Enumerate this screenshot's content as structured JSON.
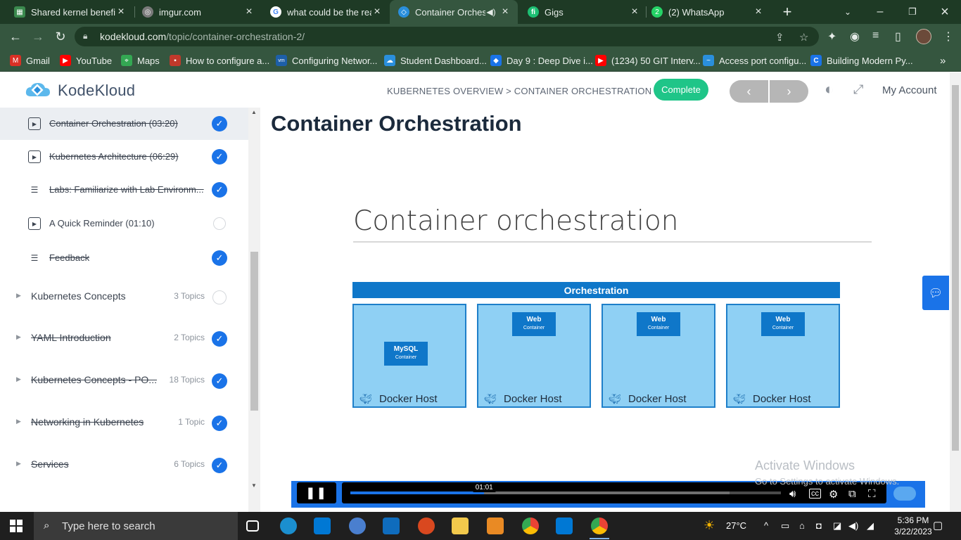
{
  "browser": {
    "tabs": [
      {
        "title": "Shared kernel benefits",
        "icon": "page-icon",
        "color": "#3b8a4e"
      },
      {
        "title": "imgur.com",
        "icon": "globe-icon",
        "color": "#7a7a7a"
      },
      {
        "title": "what could be the rea",
        "icon": "google-icon",
        "color": "#ffffff"
      },
      {
        "title": "Container Orchest",
        "icon": "kodekloud-icon",
        "color": "#2a8fdc",
        "active": true
      },
      {
        "title": "Gigs",
        "icon": "fiverr-icon",
        "color": "#1dbf73"
      },
      {
        "title": "(2) WhatsApp",
        "icon": "whatsapp-icon",
        "color": "#25d366"
      }
    ],
    "url_host": "kodekloud.com",
    "url_path": "/topic/container-orchestration-2/",
    "bookmarks": [
      {
        "label": "Gmail",
        "icon": "gmail-icon",
        "color": "#d93025"
      },
      {
        "label": "YouTube",
        "icon": "youtube-icon",
        "color": "#ff0000"
      },
      {
        "label": "Maps",
        "icon": "maps-icon",
        "color": "#34a853"
      },
      {
        "label": "How to configure a...",
        "icon": "bookmark-icon",
        "color": "#c0392b"
      },
      {
        "label": "Configuring Networ...",
        "icon": "vmware-icon",
        "color": "#1d5fa8"
      },
      {
        "label": "Student Dashboard...",
        "icon": "cloud-icon",
        "color": "#2a8fdc"
      },
      {
        "label": "Day 9 : Deep Dive i...",
        "icon": "diamond-icon",
        "color": "#1a73e8"
      },
      {
        "label": "(1234) 50 GIT Interv...",
        "icon": "youtube-icon",
        "color": "#ff0000"
      },
      {
        "label": "Access port configu...",
        "icon": "wave-icon",
        "color": "#2a8fdc"
      },
      {
        "label": "Building Modern Py...",
        "icon": "c-icon",
        "color": "#1a73e8"
      }
    ]
  },
  "header": {
    "logo_text": "KodeKloud",
    "breadcrumb": "KUBERNETES OVERVIEW > CONTAINER ORCHESTRATION",
    "complete_label": "Complete",
    "prev_label": "‹",
    "next_label": "›",
    "account_label": "My Account"
  },
  "sidebar": {
    "lessons": [
      {
        "label": "Container Orchestration (03:20)",
        "type": "video",
        "done": true,
        "current": true
      },
      {
        "label": "Kubernetes Architecture (06:29)",
        "type": "video",
        "done": true
      },
      {
        "label": "Labs: Familiarize with Lab Environm...",
        "type": "lab",
        "done": true
      },
      {
        "label": "A Quick Reminder (01:10)",
        "type": "video",
        "done": false
      },
      {
        "label": "Feedback",
        "type": "lab",
        "done": true
      }
    ],
    "sections": [
      {
        "label": "Kubernetes Concepts",
        "count": "3 Topics",
        "done": false
      },
      {
        "label": "YAML Introduction",
        "count": "2 Topics",
        "done": true
      },
      {
        "label": "Kubernetes Concepts - PO...",
        "count": "18 Topics",
        "done": true
      },
      {
        "label": "Networking in Kubernetes",
        "count": "1 Topic",
        "done": true
      },
      {
        "label": "Services",
        "count": "6 Topics",
        "done": true
      }
    ]
  },
  "main": {
    "title": "Container Orchestration",
    "slide": {
      "title": "Container orchestration",
      "orchestration_label": "Orchestration",
      "hosts": [
        {
          "container": "MySQL",
          "sub": "Container",
          "label": "Docker Host"
        },
        {
          "container": "Web",
          "sub": "Container",
          "label": "Docker Host"
        },
        {
          "container": "Web",
          "sub": "Container",
          "label": "Docker Host"
        },
        {
          "container": "Web",
          "sub": "Container",
          "label": "Docker Host"
        }
      ]
    },
    "video": {
      "time": "01:01",
      "progress": 0.31,
      "buffered": 0.88,
      "pause_label": "❚❚"
    }
  },
  "watermark": {
    "line1": "Activate Windows",
    "line2": "Go to Settings to activate Windows."
  },
  "taskbar": {
    "search_placeholder": "Type here to search",
    "weather": "27°C",
    "time": "5:36 PM",
    "date": "3/22/2023"
  }
}
